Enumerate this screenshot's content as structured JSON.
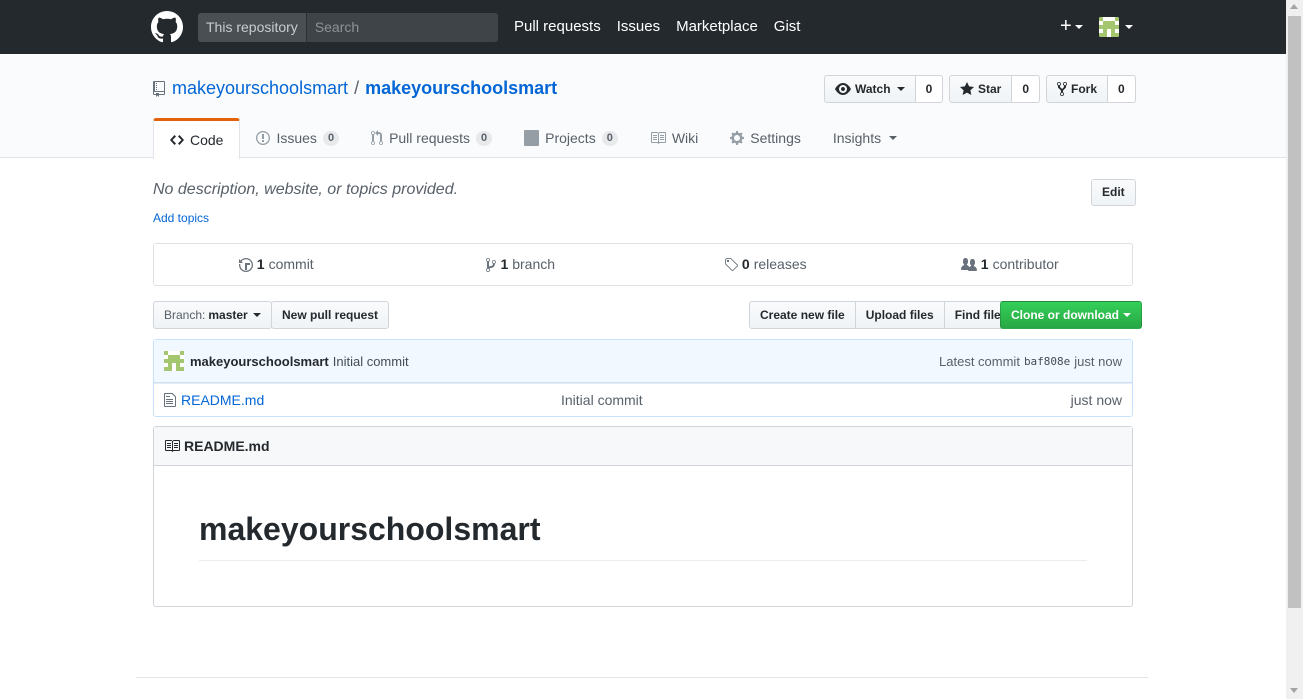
{
  "header": {
    "scope_label": "This repository",
    "search_placeholder": "Search",
    "nav": [
      "Pull requests",
      "Issues",
      "Marketplace",
      "Gist"
    ],
    "plus": "+"
  },
  "repo": {
    "owner": "makeyourschoolsmart",
    "separator": "/",
    "name": "makeyourschoolsmart",
    "watch_label": "Watch",
    "watch_count": "0",
    "star_label": "Star",
    "star_count": "0",
    "fork_label": "Fork",
    "fork_count": "0"
  },
  "tabs": {
    "code": "Code",
    "issues": "Issues",
    "issues_count": "0",
    "pulls": "Pull requests",
    "pulls_count": "0",
    "projects": "Projects",
    "projects_count": "0",
    "wiki": "Wiki",
    "settings": "Settings",
    "insights": "Insights"
  },
  "meta": {
    "description": "No description, website, or topics provided.",
    "add_topics": "Add topics",
    "edit": "Edit"
  },
  "numbers": {
    "commits_count": "1",
    "commits_label": "commit",
    "branches_count": "1",
    "branches_label": "branch",
    "releases_count": "0",
    "releases_label": "releases",
    "contributors_count": "1",
    "contributors_label": "contributor"
  },
  "file_nav": {
    "branch_prefix": "Branch:",
    "branch_name": "master",
    "new_pr": "New pull request",
    "create_file": "Create new file",
    "upload_files": "Upload files",
    "find_file": "Find file",
    "clone": "Clone or download"
  },
  "commit": {
    "author": "makeyourschoolsmart",
    "message": "Initial commit",
    "latest_label": "Latest commit",
    "sha": "baf808e",
    "age": "just now"
  },
  "files": [
    {
      "name": "README.md",
      "message": "Initial commit",
      "age": "just now"
    }
  ],
  "readme": {
    "filename": "README.md",
    "heading": "makeyourschoolsmart"
  },
  "colors": {
    "header_bg": "#24292e",
    "link": "#0366d6",
    "tab_accent": "#e36209",
    "clone_green": "#28a745"
  }
}
